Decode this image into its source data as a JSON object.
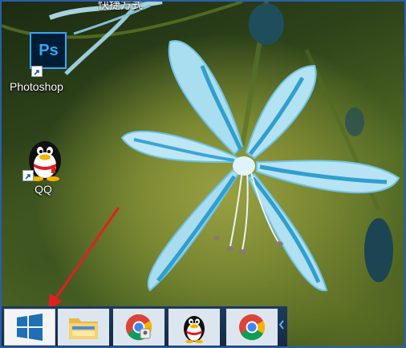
{
  "desktop": {
    "top_partial_label": "快捷方式",
    "icons": [
      {
        "name": "photoshop",
        "label": "Photoshop",
        "glyph": "Ps"
      },
      {
        "name": "qq",
        "label": "QQ"
      }
    ]
  },
  "taskbar": {
    "buttons": [
      {
        "name": "start",
        "icon": "windows-logo-icon"
      },
      {
        "name": "file-explorer",
        "icon": "folder-icon"
      },
      {
        "name": "chrome",
        "icon": "chrome-icon"
      },
      {
        "name": "qq",
        "icon": "qq-penguin-icon"
      },
      {
        "name": "chrome",
        "icon": "chrome-icon"
      }
    ]
  },
  "annotation": {
    "type": "red-arrow",
    "points_to": "start-button",
    "color": "#e02020"
  },
  "colors": {
    "photoshop_bg": "#001d34",
    "photoshop_accent": "#31a8ff",
    "taskbar": "#1e3a5c",
    "petal": "#9fd6ec",
    "petal_stripe": "#2a9fd0"
  }
}
